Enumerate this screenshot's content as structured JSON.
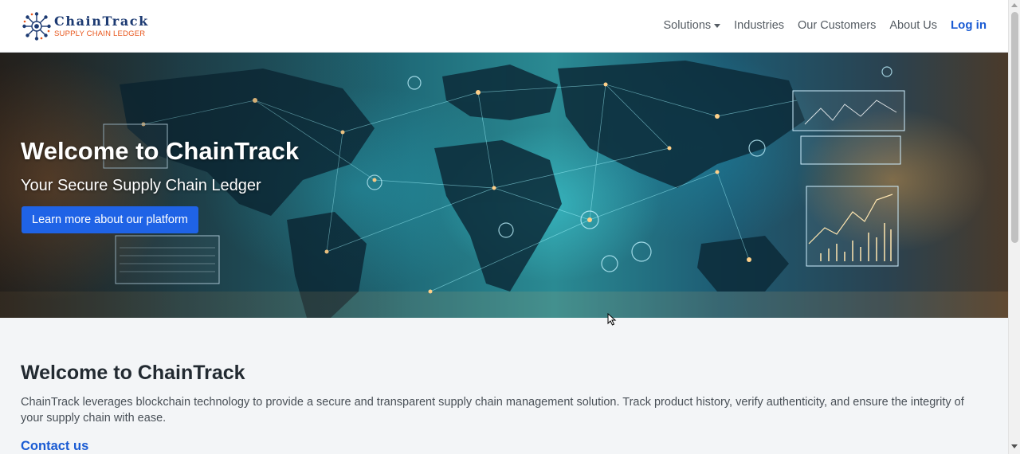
{
  "brand": {
    "name": "ChainTrack",
    "tagline": "SUPPLY CHAIN LEDGER",
    "name_color": "#1c3a72",
    "tagline_color": "#e8561c"
  },
  "nav": {
    "items": [
      {
        "label": "Solutions",
        "has_dropdown": true
      },
      {
        "label": "Industries"
      },
      {
        "label": "Our Customers"
      },
      {
        "label": "About Us"
      }
    ],
    "login_label": "Log in",
    "accent_color": "#1a5bd3"
  },
  "hero": {
    "title": "Welcome to ChainTrack",
    "subtitle": "Your Secure Supply Chain Ledger",
    "button_label": "Learn more about our platform",
    "button_color": "#1f63e6",
    "background_image": "world-network-map"
  },
  "intro": {
    "title": "Welcome to ChainTrack",
    "text": "ChainTrack leverages blockchain technology to provide a secure and transparent supply chain management solution. Track product history, verify authenticity, and ensure the integrity of your supply chain with ease.",
    "contact_label": "Contact us"
  },
  "icons": {
    "logo": "network-node-logo-icon",
    "dropdown": "caret-down-icon"
  }
}
